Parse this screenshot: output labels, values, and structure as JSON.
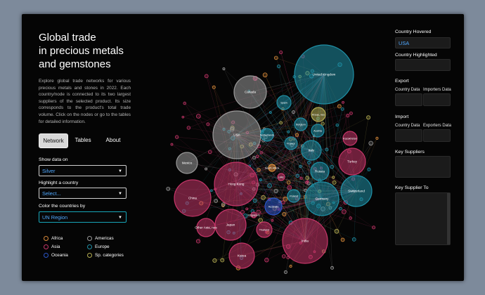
{
  "sidebar": {
    "title_lines": [
      "Global trade",
      "in precious metals",
      "and gemstones"
    ],
    "description": "Explore global trade networks for various precious metals and stones in 2022. Each country/node is connected to its two largest suppliers of the selected product. Its size corresponds to the product's total trade volume. Click on the nodes or go to the tables for detailed information.",
    "tabs": [
      "Network",
      "Tables",
      "About"
    ],
    "show_data_label": "Show data on",
    "show_data_value": "Silver",
    "highlight_label": "Highlight a country",
    "highlight_placeholder": "Select...",
    "color_label": "Color the countries by",
    "color_value": "UN Region",
    "legend": [
      {
        "label": "Africa",
        "color": "#d88a3a"
      },
      {
        "label": "Americas",
        "color": "#9a9a9a"
      },
      {
        "label": "Asia",
        "color": "#c43568"
      },
      {
        "label": "Europe",
        "color": "#1f8fa5"
      },
      {
        "label": "Oceania",
        "color": "#2a55c8"
      },
      {
        "label": "Sp. categories",
        "color": "#b5ad52"
      }
    ]
  },
  "graph": {
    "nodes": [
      {
        "label": "United Kingdom",
        "region": "Europe"
      },
      {
        "label": "Canada",
        "region": "Americas"
      },
      {
        "label": "USA",
        "region": "Americas"
      },
      {
        "label": "Spain",
        "region": "Europe"
      },
      {
        "label": "Areas, nes",
        "region": "Sp. categories"
      },
      {
        "label": "Belgium",
        "region": "Europe"
      },
      {
        "label": "Austria",
        "region": "Europe"
      },
      {
        "label": "Kazakhstan",
        "region": "Asia"
      },
      {
        "label": "Netherlands",
        "region": "Europe"
      },
      {
        "label": "France",
        "region": "Europe"
      },
      {
        "label": "Italy",
        "region": "Europe"
      },
      {
        "label": "Turkey",
        "region": "Asia"
      },
      {
        "label": "Mexico",
        "region": "Americas"
      },
      {
        "label": "Hong Kong",
        "region": "Asia"
      },
      {
        "label": "South Africa",
        "region": "Africa"
      },
      {
        "label": "UAE",
        "region": "Asia"
      },
      {
        "label": "Russia",
        "region": "Europe"
      },
      {
        "label": "Switzerland",
        "region": "Europe"
      },
      {
        "label": "China",
        "region": "Asia"
      },
      {
        "label": "Poland",
        "region": "Europe"
      },
      {
        "label": "Germany",
        "region": "Europe"
      },
      {
        "label": "Australia",
        "region": "Oceania"
      },
      {
        "label": "Singapore",
        "region": "Asia"
      },
      {
        "label": "Japan",
        "region": "Asia"
      },
      {
        "label": "Other Asia, nes",
        "region": "Asia"
      },
      {
        "label": "Thailand",
        "region": "Asia"
      },
      {
        "label": "India",
        "region": "Asia"
      },
      {
        "label": "Korea",
        "region": "Asia"
      }
    ]
  },
  "right": {
    "hovered_label": "Country Hovered",
    "hovered_value": "USA",
    "highlighted_label": "Country Highlighted",
    "export_label": "Export",
    "import_label": "Import",
    "country_data": "Country Data",
    "importers_data": "Importers Data",
    "exporters_data": "Exporters Data",
    "key_suppliers": "Key Suppliers",
    "key_supplier_to": "Key Supplier To"
  }
}
